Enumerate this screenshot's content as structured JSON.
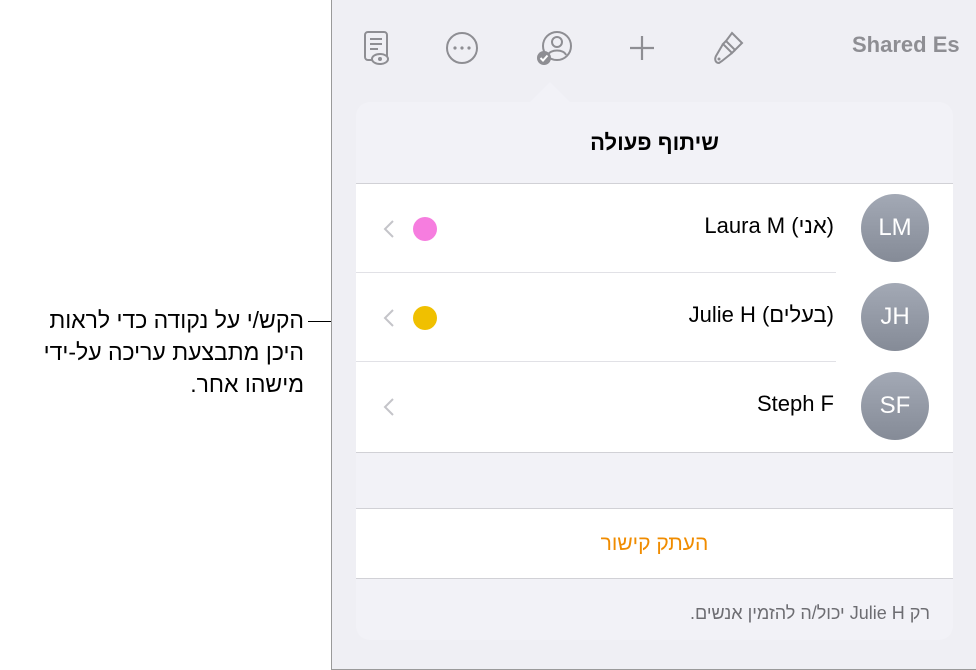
{
  "annotation": {
    "line1": "הקש/י על נקודה כדי לראות",
    "line2": "היכן מתבצעת עריכה על-ידי",
    "line3": "מישהו אחר."
  },
  "toolbar": {
    "icons": [
      "document-view-icon",
      "more-icon",
      "collaborate-icon",
      "add-icon",
      "format-brush-icon"
    ],
    "document_title": "Shared Es"
  },
  "popover": {
    "title": "שיתוף פעולה",
    "participants": [
      {
        "initials": "LM",
        "name": "Laura M (אני)",
        "dot_color": "#f67ddf"
      },
      {
        "initials": "JH",
        "name": "Julie H (בעלים)",
        "dot_color": "#f0c000"
      },
      {
        "initials": "SF",
        "name": "Steph F",
        "dot_color": ""
      }
    ],
    "copy_link_label": "העתק קישור",
    "footer_note": "רק Julie H יכול/ה להזמין אנשים."
  },
  "colors": {
    "accent": "#f08c00",
    "toolbar_icon": "#8e8e93",
    "avatar": "#959ba7"
  }
}
